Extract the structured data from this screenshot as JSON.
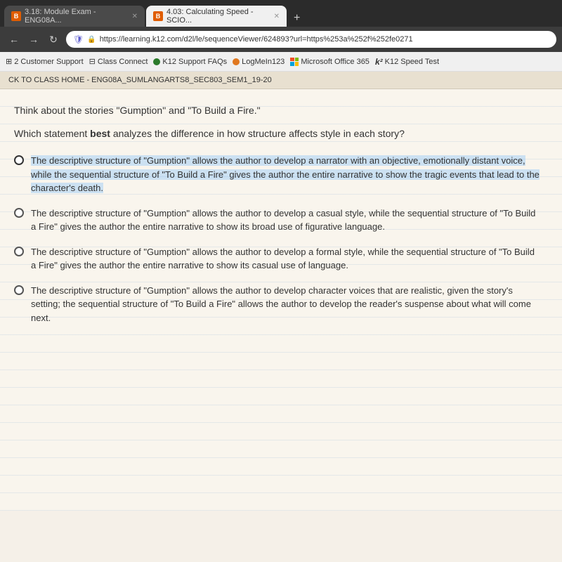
{
  "browser": {
    "tabs": [
      {
        "id": "tab1",
        "label": "3.18: Module Exam - ENG08A...",
        "icon": "B",
        "active": false
      },
      {
        "id": "tab2",
        "label": "4.03: Calculating Speed - SCIO...",
        "icon": "B",
        "active": true
      }
    ],
    "new_tab_label": "+",
    "address_bar": {
      "url": "https://learning.k12.com/d2l/le/sequenceViewer/624893?url=https%253a%252f%252fe0271",
      "shield": "🛡",
      "lock": "🔒"
    },
    "bookmarks": [
      {
        "id": "customer-support",
        "label": "2 Customer Support",
        "icon": "bookmark"
      },
      {
        "id": "class-connect",
        "label": "Class Connect",
        "icon": "grid"
      },
      {
        "id": "k12-support",
        "label": "K12 Support FAQs",
        "icon": "circle-green"
      },
      {
        "id": "logmein",
        "label": "LogMeIn123",
        "icon": "circle-orange"
      },
      {
        "id": "microsoft",
        "label": "Microsoft Office 365",
        "icon": "grid-color"
      },
      {
        "id": "k12-speed",
        "label": "K12 Speed Test",
        "icon": "k-bold"
      }
    ]
  },
  "page": {
    "back_link": "CK TO CLASS HOME - ENG08A_SUMLANGARTS8_SEC803_SEM1_19-20",
    "question_intro": "Think about the stories \"Gumption\" and \"To Build a Fire.\"",
    "question_text": "Which statement best analyzes the difference in how structure affects style in each story?",
    "options": [
      {
        "id": "opt1",
        "selected": true,
        "text": "The descriptive structure of \"Gumption\" allows the author to develop a narrator with an objective, emotionally distant voice, while the sequential structure of \"To Build a Fire\" gives the author the entire narrative to show the tragic events that lead to the character's death."
      },
      {
        "id": "opt2",
        "selected": false,
        "text": "The descriptive structure of \"Gumption\" allows the author to develop a casual style, while the sequential structure of \"To Build a Fire\" gives the author the entire narrative to show its broad use of figurative language."
      },
      {
        "id": "opt3",
        "selected": false,
        "text": "The descriptive structure of \"Gumption\" allows the author to develop a formal style, while the sequential structure of \"To Build a Fire\" gives the author the entire narrative to show its casual use of language."
      },
      {
        "id": "opt4",
        "selected": false,
        "text": "The descriptive structure of \"Gumption\" allows the author to develop character voices that are realistic, given the story's setting; the sequential structure of \"To Build a Fire\" allows the author to develop the reader's suspense about what will come next."
      }
    ]
  }
}
